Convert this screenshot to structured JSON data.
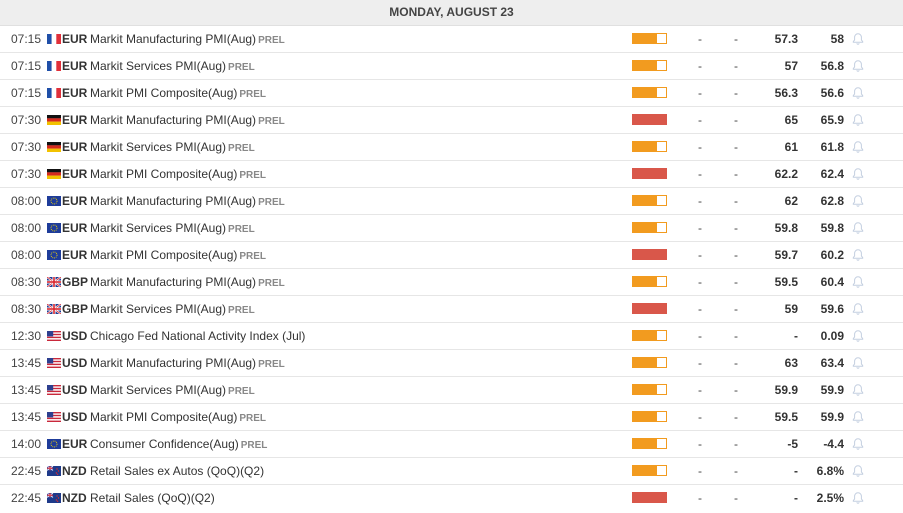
{
  "header": {
    "title": "MONDAY, AUGUST 23"
  },
  "colors": {
    "medium": "#f29b1f",
    "high": "#d9574a"
  },
  "events": [
    {
      "time": "07:15",
      "flag": "fr-flag-icon",
      "currency": "EUR",
      "name": "Markit Manufacturing PMI(Aug)",
      "tag": "PREL",
      "impact": "medium",
      "actual": "-",
      "deviation": "-",
      "consensus": "57.3",
      "previous": "58"
    },
    {
      "time": "07:15",
      "flag": "fr-flag-icon",
      "currency": "EUR",
      "name": "Markit Services PMI(Aug)",
      "tag": "PREL",
      "impact": "medium",
      "actual": "-",
      "deviation": "-",
      "consensus": "57",
      "previous": "56.8"
    },
    {
      "time": "07:15",
      "flag": "fr-flag-icon",
      "currency": "EUR",
      "name": "Markit PMI Composite(Aug)",
      "tag": "PREL",
      "impact": "medium",
      "actual": "-",
      "deviation": "-",
      "consensus": "56.3",
      "previous": "56.6"
    },
    {
      "time": "07:30",
      "flag": "de-flag-icon",
      "currency": "EUR",
      "name": "Markit Manufacturing PMI(Aug)",
      "tag": "PREL",
      "impact": "high",
      "actual": "-",
      "deviation": "-",
      "consensus": "65",
      "previous": "65.9"
    },
    {
      "time": "07:30",
      "flag": "de-flag-icon",
      "currency": "EUR",
      "name": "Markit Services PMI(Aug)",
      "tag": "PREL",
      "impact": "medium",
      "actual": "-",
      "deviation": "-",
      "consensus": "61",
      "previous": "61.8"
    },
    {
      "time": "07:30",
      "flag": "de-flag-icon",
      "currency": "EUR",
      "name": "Markit PMI Composite(Aug)",
      "tag": "PREL",
      "impact": "high",
      "actual": "-",
      "deviation": "-",
      "consensus": "62.2",
      "previous": "62.4"
    },
    {
      "time": "08:00",
      "flag": "eu-flag-icon",
      "currency": "EUR",
      "name": "Markit Manufacturing PMI(Aug)",
      "tag": "PREL",
      "impact": "medium",
      "actual": "-",
      "deviation": "-",
      "consensus": "62",
      "previous": "62.8"
    },
    {
      "time": "08:00",
      "flag": "eu-flag-icon",
      "currency": "EUR",
      "name": "Markit Services PMI(Aug)",
      "tag": "PREL",
      "impact": "medium",
      "actual": "-",
      "deviation": "-",
      "consensus": "59.8",
      "previous": "59.8"
    },
    {
      "time": "08:00",
      "flag": "eu-flag-icon",
      "currency": "EUR",
      "name": "Markit PMI Composite(Aug)",
      "tag": "PREL",
      "impact": "high",
      "actual": "-",
      "deviation": "-",
      "consensus": "59.7",
      "previous": "60.2"
    },
    {
      "time": "08:30",
      "flag": "gb-flag-icon",
      "currency": "GBP",
      "name": "Markit Manufacturing PMI(Aug)",
      "tag": "PREL",
      "impact": "medium",
      "actual": "-",
      "deviation": "-",
      "consensus": "59.5",
      "previous": "60.4"
    },
    {
      "time": "08:30",
      "flag": "gb-flag-icon",
      "currency": "GBP",
      "name": "Markit Services PMI(Aug)",
      "tag": "PREL",
      "impact": "high",
      "actual": "-",
      "deviation": "-",
      "consensus": "59",
      "previous": "59.6"
    },
    {
      "time": "12:30",
      "flag": "us-flag-icon",
      "currency": "USD",
      "name": "Chicago Fed National Activity Index (Jul)",
      "tag": "",
      "impact": "medium",
      "actual": "-",
      "deviation": "-",
      "consensus": "-",
      "previous": "0.09"
    },
    {
      "time": "13:45",
      "flag": "us-flag-icon",
      "currency": "USD",
      "name": "Markit Manufacturing PMI(Aug)",
      "tag": "PREL",
      "impact": "medium",
      "actual": "-",
      "deviation": "-",
      "consensus": "63",
      "previous": "63.4"
    },
    {
      "time": "13:45",
      "flag": "us-flag-icon",
      "currency": "USD",
      "name": "Markit Services PMI(Aug)",
      "tag": "PREL",
      "impact": "medium",
      "actual": "-",
      "deviation": "-",
      "consensus": "59.9",
      "previous": "59.9"
    },
    {
      "time": "13:45",
      "flag": "us-flag-icon",
      "currency": "USD",
      "name": "Markit PMI Composite(Aug)",
      "tag": "PREL",
      "impact": "medium",
      "actual": "-",
      "deviation": "-",
      "consensus": "59.5",
      "previous": "59.9"
    },
    {
      "time": "14:00",
      "flag": "eu-flag-icon",
      "currency": "EUR",
      "name": "Consumer Confidence(Aug)",
      "tag": "PREL",
      "impact": "medium",
      "actual": "-",
      "deviation": "-",
      "consensus": "-5",
      "previous": "-4.4"
    },
    {
      "time": "22:45",
      "flag": "nz-flag-icon",
      "currency": "NZD",
      "name": "Retail Sales ex Autos (QoQ)(Q2)",
      "tag": "",
      "impact": "medium",
      "actual": "-",
      "deviation": "-",
      "consensus": "-",
      "previous": "6.8%"
    },
    {
      "time": "22:45",
      "flag": "nz-flag-icon",
      "currency": "NZD",
      "name": "Retail Sales (QoQ)(Q2)",
      "tag": "",
      "impact": "high",
      "actual": "-",
      "deviation": "-",
      "consensus": "-",
      "previous": "2.5%"
    }
  ]
}
